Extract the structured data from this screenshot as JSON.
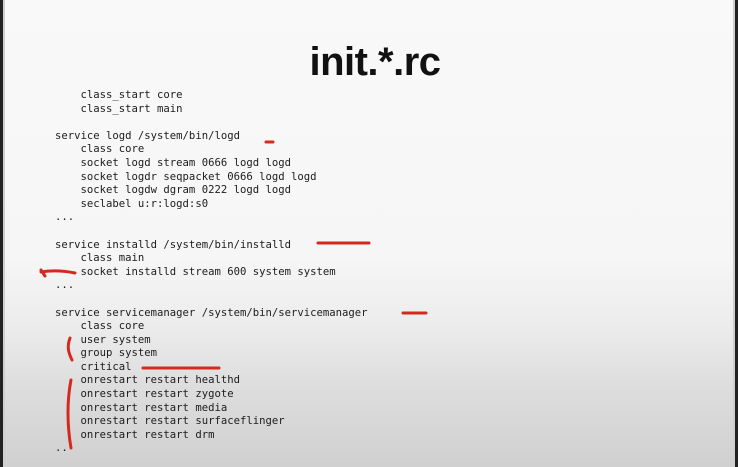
{
  "slide": {
    "title": "init.*.rc",
    "code_lines": [
      "    class_start core",
      "    class_start main",
      "",
      "service logd /system/bin/logd",
      "    class core",
      "    socket logd stream 0666 logd logd",
      "    socket logdr seqpacket 0666 logd logd",
      "    socket logdw dgram 0222 logd logd",
      "    seclabel u:r:logd:s0",
      "...",
      "",
      "service installd /system/bin/installd",
      "    class main",
      "    socket installd stream 600 system system",
      "...",
      "",
      "service servicemanager /system/bin/servicemanager",
      "    class core",
      "    user system",
      "    group system",
      "    critical",
      "    onrestart restart healthd",
      "    onrestart restart zygote",
      "    onrestart restart media",
      "    onrestart restart surfaceflinger",
      "    onrestart restart drm",
      ".."
    ]
  },
  "colors": {
    "annotation_red": "#d42a1e",
    "text": "#1c1c1c",
    "title": "#111111"
  }
}
